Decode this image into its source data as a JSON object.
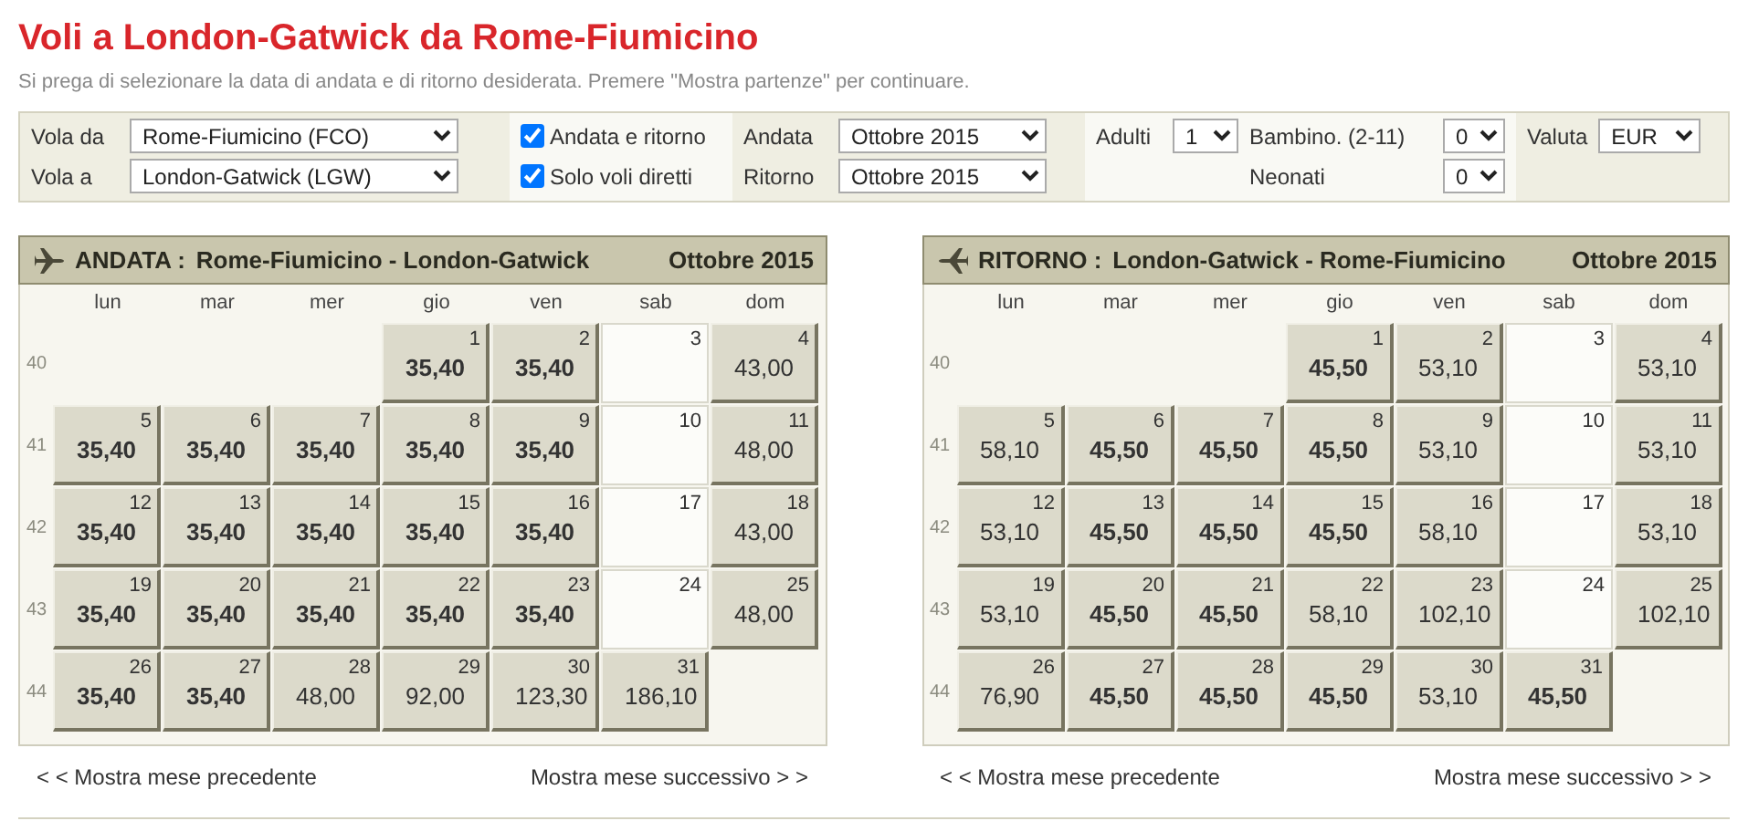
{
  "title": "Voli a London-Gatwick da Rome-Fiumicino",
  "subtitle": "Si prega di selezionare la data di andata e di ritorno desiderata. Premere \"Mostra partenze\" per continuare.",
  "search_form": {
    "columns": [
      {
        "rows": [
          [
            {
              "kind": "select",
              "label": "Vola da",
              "value": "Rome-Fiumicino (FCO)"
            }
          ],
          [
            {
              "kind": "select",
              "label": "Vola a",
              "value": "London-Gatwick (LGW)"
            }
          ]
        ]
      },
      {
        "rows": [
          [
            {
              "kind": "checkbox",
              "label": "Andata e ritorno",
              "checked": true
            }
          ],
          [
            {
              "kind": "checkbox",
              "label": "Solo voli diretti",
              "checked": true
            }
          ]
        ]
      },
      {
        "rows": [
          [
            {
              "kind": "select",
              "label": "Andata",
              "value": "Ottobre 2015"
            }
          ],
          [
            {
              "kind": "select",
              "label": "Ritorno",
              "value": "Ottobre 2015"
            }
          ]
        ]
      },
      {
        "rows": [
          [
            {
              "kind": "select",
              "label": "Adulti",
              "value": "1"
            },
            {
              "kind": "select",
              "label": "Bambino. (2-11)",
              "value": "0"
            }
          ],
          [
            "",
            {
              "kind": "select",
              "label": "Neonati",
              "value": "0"
            }
          ]
        ]
      },
      {
        "rows": [
          [
            {
              "kind": "select",
              "label": "Valuta",
              "value": "EUR"
            }
          ]
        ]
      }
    ]
  },
  "calendars": [
    {
      "kind": "outbound",
      "label": "ANDATA :",
      "route": "Rome-Fiumicino - London-Gatwick",
      "month": "Ottobre 2015",
      "weekdays": [
        "lun",
        "mar",
        "mer",
        "gio",
        "ven",
        "sab",
        "dom"
      ],
      "weeks": [
        {
          "number": "40",
          "days": [
            {
              "kind": "blank"
            },
            {
              "kind": "blank"
            },
            {
              "kind": "blank"
            },
            {
              "kind": "fare",
              "day": "1",
              "price": "35,40",
              "cheapest": true
            },
            {
              "kind": "fare",
              "day": "2",
              "price": "35,40",
              "cheapest": true
            },
            {
              "kind": "none",
              "day": "3"
            },
            {
              "kind": "fare",
              "day": "4",
              "price": "43,00",
              "cheapest": false
            }
          ]
        },
        {
          "number": "41",
          "days": [
            {
              "kind": "fare",
              "day": "5",
              "price": "35,40",
              "cheapest": true
            },
            {
              "kind": "fare",
              "day": "6",
              "price": "35,40",
              "cheapest": true
            },
            {
              "kind": "fare",
              "day": "7",
              "price": "35,40",
              "cheapest": true
            },
            {
              "kind": "fare",
              "day": "8",
              "price": "35,40",
              "cheapest": true
            },
            {
              "kind": "fare",
              "day": "9",
              "price": "35,40",
              "cheapest": true
            },
            {
              "kind": "none",
              "day": "10"
            },
            {
              "kind": "fare",
              "day": "11",
              "price": "48,00",
              "cheapest": false
            }
          ]
        },
        {
          "number": "42",
          "days": [
            {
              "kind": "fare",
              "day": "12",
              "price": "35,40",
              "cheapest": true
            },
            {
              "kind": "fare",
              "day": "13",
              "price": "35,40",
              "cheapest": true
            },
            {
              "kind": "fare",
              "day": "14",
              "price": "35,40",
              "cheapest": true
            },
            {
              "kind": "fare",
              "day": "15",
              "price": "35,40",
              "cheapest": true
            },
            {
              "kind": "fare",
              "day": "16",
              "price": "35,40",
              "cheapest": true
            },
            {
              "kind": "none",
              "day": "17"
            },
            {
              "kind": "fare",
              "day": "18",
              "price": "43,00",
              "cheapest": false
            }
          ]
        },
        {
          "number": "43",
          "days": [
            {
              "kind": "fare",
              "day": "19",
              "price": "35,40",
              "cheapest": true
            },
            {
              "kind": "fare",
              "day": "20",
              "price": "35,40",
              "cheapest": true
            },
            {
              "kind": "fare",
              "day": "21",
              "price": "35,40",
              "cheapest": true
            },
            {
              "kind": "fare",
              "day": "22",
              "price": "35,40",
              "cheapest": true
            },
            {
              "kind": "fare",
              "day": "23",
              "price": "35,40",
              "cheapest": true
            },
            {
              "kind": "none",
              "day": "24"
            },
            {
              "kind": "fare",
              "day": "25",
              "price": "48,00",
              "cheapest": false
            }
          ]
        },
        {
          "number": "44",
          "days": [
            {
              "kind": "fare",
              "day": "26",
              "price": "35,40",
              "cheapest": true
            },
            {
              "kind": "fare",
              "day": "27",
              "price": "35,40",
              "cheapest": true
            },
            {
              "kind": "fare",
              "day": "28",
              "price": "48,00",
              "cheapest": false
            },
            {
              "kind": "fare",
              "day": "29",
              "price": "92,00",
              "cheapest": false
            },
            {
              "kind": "fare",
              "day": "30",
              "price": "123,30",
              "cheapest": false
            },
            {
              "kind": "fare",
              "day": "31",
              "price": "186,10",
              "cheapest": false
            },
            {
              "kind": "blank"
            }
          ]
        }
      ],
      "prev_link": "< < Mostra mese precedente",
      "next_link": "Mostra mese successivo > >"
    },
    {
      "kind": "return",
      "label": "RITORNO :",
      "route": "London-Gatwick - Rome-Fiumicino",
      "month": "Ottobre 2015",
      "weekdays": [
        "lun",
        "mar",
        "mer",
        "gio",
        "ven",
        "sab",
        "dom"
      ],
      "weeks": [
        {
          "number": "40",
          "days": [
            {
              "kind": "blank"
            },
            {
              "kind": "blank"
            },
            {
              "kind": "blank"
            },
            {
              "kind": "fare",
              "day": "1",
              "price": "45,50",
              "cheapest": true
            },
            {
              "kind": "fare",
              "day": "2",
              "price": "53,10",
              "cheapest": false
            },
            {
              "kind": "none",
              "day": "3"
            },
            {
              "kind": "fare",
              "day": "4",
              "price": "53,10",
              "cheapest": false
            }
          ]
        },
        {
          "number": "41",
          "days": [
            {
              "kind": "fare",
              "day": "5",
              "price": "58,10",
              "cheapest": false
            },
            {
              "kind": "fare",
              "day": "6",
              "price": "45,50",
              "cheapest": true
            },
            {
              "kind": "fare",
              "day": "7",
              "price": "45,50",
              "cheapest": true
            },
            {
              "kind": "fare",
              "day": "8",
              "price": "45,50",
              "cheapest": true
            },
            {
              "kind": "fare",
              "day": "9",
              "price": "53,10",
              "cheapest": false
            },
            {
              "kind": "none",
              "day": "10"
            },
            {
              "kind": "fare",
              "day": "11",
              "price": "53,10",
              "cheapest": false
            }
          ]
        },
        {
          "number": "42",
          "days": [
            {
              "kind": "fare",
              "day": "12",
              "price": "53,10",
              "cheapest": false
            },
            {
              "kind": "fare",
              "day": "13",
              "price": "45,50",
              "cheapest": true
            },
            {
              "kind": "fare",
              "day": "14",
              "price": "45,50",
              "cheapest": true
            },
            {
              "kind": "fare",
              "day": "15",
              "price": "45,50",
              "cheapest": true
            },
            {
              "kind": "fare",
              "day": "16",
              "price": "58,10",
              "cheapest": false
            },
            {
              "kind": "none",
              "day": "17"
            },
            {
              "kind": "fare",
              "day": "18",
              "price": "53,10",
              "cheapest": false
            }
          ]
        },
        {
          "number": "43",
          "days": [
            {
              "kind": "fare",
              "day": "19",
              "price": "53,10",
              "cheapest": false
            },
            {
              "kind": "fare",
              "day": "20",
              "price": "45,50",
              "cheapest": true
            },
            {
              "kind": "fare",
              "day": "21",
              "price": "45,50",
              "cheapest": true
            },
            {
              "kind": "fare",
              "day": "22",
              "price": "58,10",
              "cheapest": false
            },
            {
              "kind": "fare",
              "day": "23",
              "price": "102,10",
              "cheapest": false
            },
            {
              "kind": "none",
              "day": "24"
            },
            {
              "kind": "fare",
              "day": "25",
              "price": "102,10",
              "cheapest": false
            }
          ]
        },
        {
          "number": "44",
          "days": [
            {
              "kind": "fare",
              "day": "26",
              "price": "76,90",
              "cheapest": false
            },
            {
              "kind": "fare",
              "day": "27",
              "price": "45,50",
              "cheapest": true
            },
            {
              "kind": "fare",
              "day": "28",
              "price": "45,50",
              "cheapest": true
            },
            {
              "kind": "fare",
              "day": "29",
              "price": "45,50",
              "cheapest": true
            },
            {
              "kind": "fare",
              "day": "30",
              "price": "53,10",
              "cheapest": false
            },
            {
              "kind": "fare",
              "day": "31",
              "price": "45,50",
              "cheapest": true
            },
            {
              "kind": "blank"
            }
          ]
        }
      ],
      "prev_link": "< < Mostra mese precedente",
      "next_link": "Mostra mese successivo > >"
    }
  ]
}
